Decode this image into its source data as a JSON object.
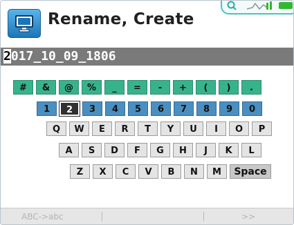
{
  "title_bar": {
    "title": "Rename, Create",
    "app_icon": "monitor-icon"
  },
  "status": {
    "icons": [
      "search-icon",
      "signal-icon",
      "battery-icon"
    ],
    "battery_color": "#2fb82f"
  },
  "name_field": {
    "first_char": "2",
    "rest": "017_10_09_1806"
  },
  "keyboard": {
    "symbols": [
      "#",
      "&",
      "@",
      "%",
      "_",
      "=",
      "-",
      "+",
      "(",
      ")",
      "."
    ],
    "numbers": [
      "1",
      "2",
      "3",
      "4",
      "5",
      "6",
      "7",
      "8",
      "9",
      "0"
    ],
    "selected_key": "2",
    "row_qwerty": [
      "Q",
      "W",
      "E",
      "R",
      "T",
      "Y",
      "U",
      "I",
      "O",
      "P"
    ],
    "row_asdf": [
      "A",
      "S",
      "D",
      "F",
      "G",
      "H",
      "J",
      "K",
      "L"
    ],
    "row_zxcv": [
      "Z",
      "X",
      "C",
      "V",
      "B",
      "N",
      "M"
    ],
    "space_label": "Space"
  },
  "footer": {
    "softkey1": "ABC->abc",
    "softkey2": "",
    "softkey3": "",
    "softkey4": ">>"
  },
  "colors": {
    "symbol_key": "#37b38b",
    "number_key": "#4b8fc0",
    "letter_key": "#e4e4e4",
    "field_bg": "#7a7a7a"
  }
}
